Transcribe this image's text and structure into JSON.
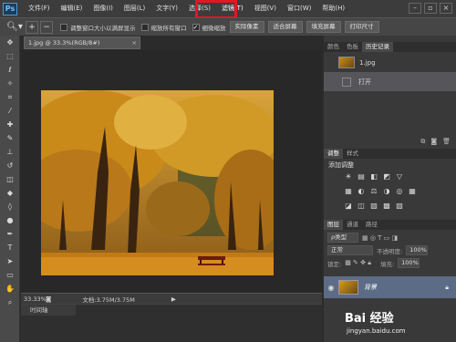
{
  "app": {
    "logo": "Ps"
  },
  "menu": [
    "文件(F)",
    "编辑(E)",
    "图像(I)",
    "图层(L)",
    "文字(Y)",
    "选择(S)",
    "滤镜(T)",
    "视图(V)",
    "窗口(W)",
    "帮助(H)"
  ],
  "highlight_color": "#e0191f",
  "options": {
    "chk_resize": "调整窗口大小以满屏显示",
    "chk_zoom_all": "缩放所有窗口",
    "chk_scrubby": "细微缩放",
    "btn_actual": "实际像素",
    "btn_fit": "适合屏幕",
    "btn_fill": "填充屏幕",
    "btn_print": "打印尺寸"
  },
  "document": {
    "tab": "1.jpg @ 33.3%(RGB/8#)",
    "zoom": "33.33%",
    "doc_size": "文档:3.75M/3.75M"
  },
  "timeline_label": "时间轴",
  "panels": {
    "top_tabs": [
      "颜色",
      "色板",
      "历史记录"
    ],
    "history": [
      {
        "label": "1.jpg"
      },
      {
        "label": "打开"
      }
    ],
    "adj_tabs": [
      "调整",
      "样式"
    ],
    "adj_title": "添加调整",
    "adj_row1": [
      "☀",
      "▤",
      "◧",
      "◩",
      "▽"
    ],
    "adj_row2": [
      "▦",
      "◐",
      "⚖",
      "◑",
      "◎",
      "▦"
    ],
    "adj_row3": [
      "◪",
      "◫",
      "▨",
      "▩",
      "▧"
    ],
    "layer_tabs": [
      "图层",
      "通道",
      "路径"
    ],
    "kind": "ρ类型",
    "blend": "正常",
    "opacity_label": "不透明度:",
    "opacity": "100%",
    "lock_label": "锁定:",
    "fill_label": "填充:",
    "fill": "100%",
    "layer_name": "背景"
  },
  "watermark": {
    "text": "Bai 经验",
    "url": "jingyan.baidu.com"
  }
}
